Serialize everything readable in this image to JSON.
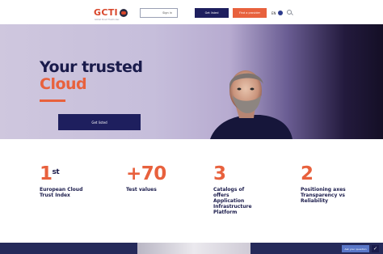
{
  "header": {
    "logo_text": "GCTI",
    "logo_subtitle": "Global Cloud Trust Index",
    "signin_label": "Sign in",
    "btn_dark_label": "Get listed",
    "btn_orange_label": "Find a provider",
    "lang_label": "EN",
    "search_icon": "search-icon"
  },
  "hero": {
    "title_line1": "Your trusted",
    "title_line2": "Cloud",
    "cta_label": "Get listed",
    "colors": {
      "title": "#1a1b4b",
      "accent": "#e8613d",
      "button": "#1e1f5e"
    }
  },
  "stats": [
    {
      "number": "1",
      "sup": "st",
      "label": "European Cloud Trust Index"
    },
    {
      "number": "+70",
      "sup": "",
      "label": "Test values"
    },
    {
      "number": "3",
      "sup": "",
      "label": "Catalogs of offers Application Infrastructure Platform"
    },
    {
      "number": "2",
      "sup": "",
      "label": "Positioning axes Transparency vs Reliability"
    }
  ],
  "footer": {
    "chat_label": "Ask your question",
    "chat_icon": "check-icon"
  }
}
